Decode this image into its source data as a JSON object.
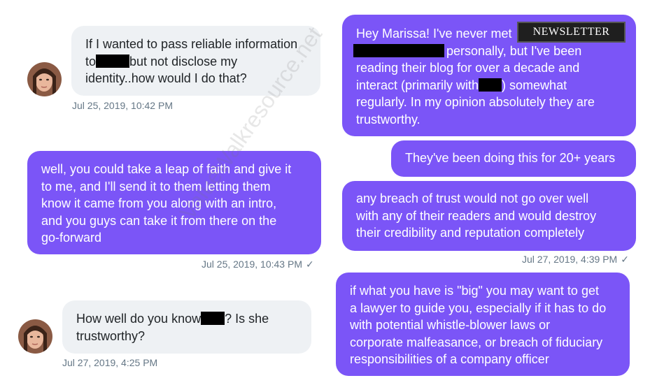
{
  "messages": {
    "m1": {
      "line1": "If I wanted to pass reliable information",
      "line2_pre": "to",
      "line2_post": "but not disclose my",
      "line3": "identity..how would I do that?",
      "timestamp": "Jul 25, 2019, 10:42 PM"
    },
    "m2": {
      "line1": "Hey Marissa! I've never met",
      "line2_post": "personally, but I've been",
      "line3": "reading their blog for over a decade and",
      "line4_pre": "interact (primarily with",
      "line4_post": ") somewhat",
      "line5": "regularly. In my opinion absolutely they are",
      "line6": "trustworthy."
    },
    "m3": {
      "text": "They've been doing this for 20+ years"
    },
    "m4": {
      "line1": "well, you could take a leap of faith and give it",
      "line2": "to me, and I'll send it to them letting them",
      "line3": "know it came from you along with an intro,",
      "line4": "and you guys can take it from there on the",
      "line5": "go-forward",
      "timestamp": "Jul 25, 2019, 10:43 PM"
    },
    "m5": {
      "line1": "any breach of trust would not go over well",
      "line2": "with any of their readers and would destroy",
      "line3": "their credibility and reputation completely",
      "timestamp": "Jul 27, 2019, 4:39 PM"
    },
    "m6": {
      "line1": "if what you have is \"big\" you may want to get",
      "line2": "a lawyer to guide you, especially if it has to do",
      "line3": "with potential whistle-blower laws or",
      "line4": "corporate malfeasance, or breach of fiduciary",
      "line5": "responsibilities of a company officer"
    },
    "m7": {
      "line1_pre": "How well do you know",
      "line1_post": "? Is she",
      "line2": "trustworthy?",
      "timestamp": "Jul 27, 2019, 4:25 PM"
    }
  },
  "overlay": {
    "newsletter_label": "NEWSLETTER",
    "watermark": "ValueWalkresource.net"
  },
  "colors": {
    "incoming_bubble": "#eef1f4",
    "outgoing_bubble": "#7b55f7",
    "timestamp": "#657786"
  },
  "icons": {
    "read_receipt": "check-icon"
  }
}
